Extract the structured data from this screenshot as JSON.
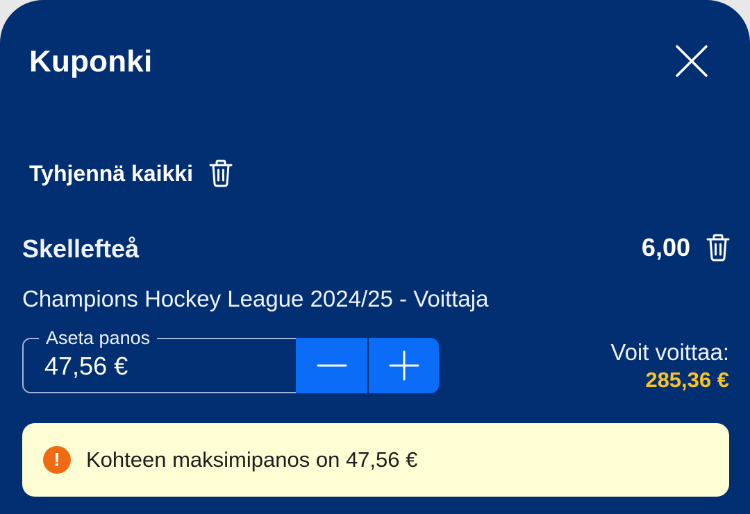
{
  "header": {
    "title": "Kuponki",
    "close_icon": "close-icon"
  },
  "actions": {
    "clear_all_label": "Tyhjennä kaikki",
    "clear_all_icon": "trash-icon"
  },
  "selection": {
    "team": "Skellefteå",
    "odds": "6,00",
    "remove_icon": "trash-icon",
    "event": "Champions Hockey League 2024/25 - Voittaja"
  },
  "stake": {
    "label": "Aseta panos",
    "value": "47,56 €",
    "decrement_icon": "minus-icon",
    "increment_icon": "plus-icon"
  },
  "winnings": {
    "label": "Voit voittaa:",
    "amount": "285,36 €"
  },
  "notice": {
    "icon": "warning-icon",
    "icon_glyph": "!",
    "text": "Kohteen maksimipanos on 47,56 €"
  },
  "colors": {
    "background": "#022e72",
    "accent": "#0a6cf7",
    "winnings": "#f7c325",
    "notice_bg": "#fffdd3",
    "warning": "#ef6a12"
  }
}
